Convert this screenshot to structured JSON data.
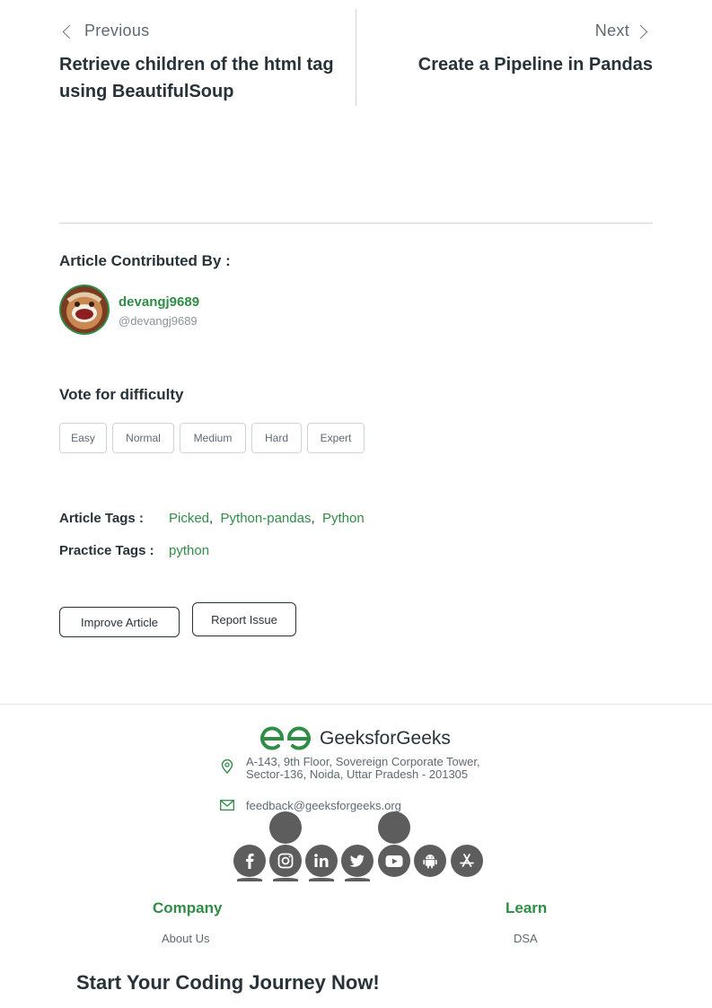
{
  "nav": {
    "previous_label": "Previous",
    "previous_title": "Retrieve children of the html tag using BeautifulSoup",
    "next_label": "Next",
    "next_title": "Create a Pipeline in Pandas"
  },
  "contributor": {
    "heading": "Article Contributed By :",
    "name": "devangj9689",
    "handle": "@devangj9689"
  },
  "difficulty": {
    "heading": "Vote for difficulty",
    "options": [
      "Easy",
      "Normal",
      "Medium",
      "Hard",
      "Expert"
    ]
  },
  "tags": {
    "article_label": "Article Tags :",
    "article": [
      "Picked",
      "Python-pandas",
      "Python"
    ],
    "practice_label": "Practice Tags :",
    "practice": [
      "python"
    ]
  },
  "actions": {
    "improve": "Improve Article",
    "report": "Report Issue"
  },
  "footer": {
    "brand": "GeeksforGeeks",
    "address_line1": "A-143, 9th Floor, Sovereign Corporate Tower,",
    "address_line2": "Sector-136, Noida, Uttar Pradesh - 201305",
    "email": "feedback@geeksforgeeks.org",
    "social_icons": [
      "facebook-icon",
      "instagram-icon",
      "linkedin-icon",
      "twitter-icon",
      "youtube-icon",
      "android-icon",
      "app-store-icon"
    ],
    "company_heading": "Company",
    "company_link": "About Us",
    "learn_heading": "Learn",
    "learn_link": "DSA",
    "cta": "Start Your Coding Journey Now!"
  },
  "colors": {
    "brand_green": "#2f8d46",
    "text": "#273239",
    "icon_gray": "#5d5d5d"
  }
}
